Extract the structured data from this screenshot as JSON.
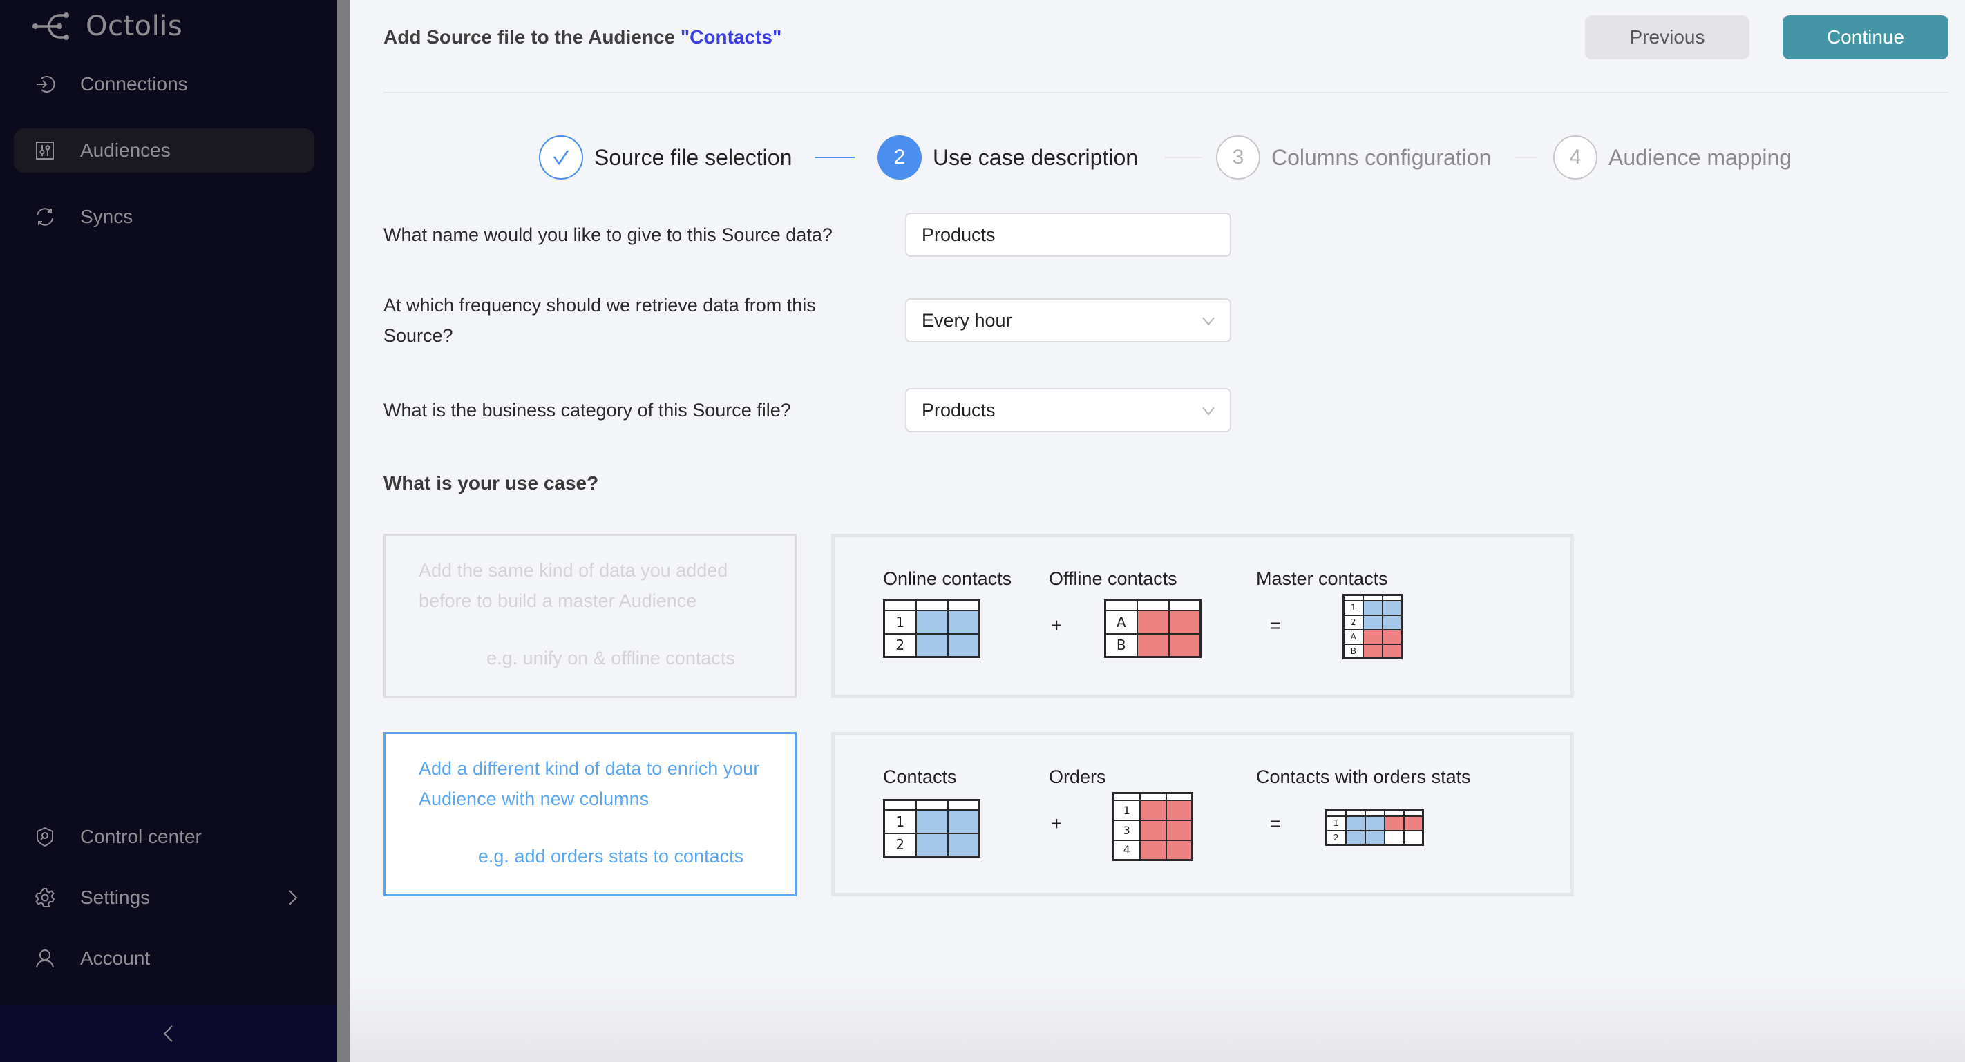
{
  "app": {
    "name": "Octolis"
  },
  "sidebar": {
    "items": [
      {
        "label": "Connections",
        "icon": "sign-in-icon",
        "active": false
      },
      {
        "label": "Audiences",
        "icon": "sliders-icon",
        "active": true
      },
      {
        "label": "Syncs",
        "icon": "sync-icon",
        "active": false
      }
    ],
    "bottom_items": [
      {
        "label": "Control center",
        "icon": "shield-search-icon"
      },
      {
        "label": "Settings",
        "icon": "gear-icon",
        "has_submenu": true
      },
      {
        "label": "Account",
        "icon": "user-icon"
      }
    ],
    "collapse_icon": "chevron-left-icon"
  },
  "header": {
    "title_prefix": "Add Source file to the Audience ",
    "audience_name": "\"Contacts\"",
    "previous_label": "Previous",
    "continue_label": "Continue",
    "accent_color": "#3b3fe0",
    "continue_color": "#4495a5"
  },
  "stepper": {
    "steps": [
      {
        "number": "1",
        "label": "Source file selection",
        "state": "done"
      },
      {
        "number": "2",
        "label": "Use case description",
        "state": "active"
      },
      {
        "number": "3",
        "label": "Columns configuration",
        "state": "pending"
      },
      {
        "number": "4",
        "label": "Audience mapping",
        "state": "pending"
      }
    ],
    "active_color": "#4a8ef0"
  },
  "form": {
    "name_question": "What name would you like to give to this Source data?",
    "name_value": "Products",
    "frequency_question": "At which frequency should we retrieve data from this Source?",
    "frequency_value": "Every hour",
    "category_question": "What is the business category of this Source file?",
    "category_value": "Products"
  },
  "use_case": {
    "title": "What is your use case?",
    "options": [
      {
        "description": "Add the same kind of data you added before to build a master Audience",
        "example": "e.g. unify on & offline contacts",
        "selected": false,
        "illustration": {
          "left_label": "Online contacts",
          "left_rows": [
            "1",
            "2"
          ],
          "operator": "+",
          "middle_label": "Offline contacts",
          "middle_rows": [
            "A",
            "B"
          ],
          "equals": "=",
          "result_label": "Master contacts",
          "result_rows": [
            "1",
            "2",
            "A",
            "B"
          ]
        }
      },
      {
        "description": "Add a different kind of data to enrich your Audience with new columns",
        "example": "e.g. add orders stats to contacts",
        "selected": true,
        "illustration": {
          "left_label": "Contacts",
          "left_rows": [
            "1",
            "2"
          ],
          "operator": "+",
          "middle_label": "Orders",
          "middle_rows": [
            "1",
            "3",
            "4"
          ],
          "equals": "=",
          "result_label": "Contacts with orders stats",
          "result_rows": [
            "1",
            "2"
          ]
        }
      }
    ],
    "selected_color": "#5ba5ef",
    "blue_cell_color": "#a5c8ea",
    "red_cell_color": "#ee8282"
  }
}
